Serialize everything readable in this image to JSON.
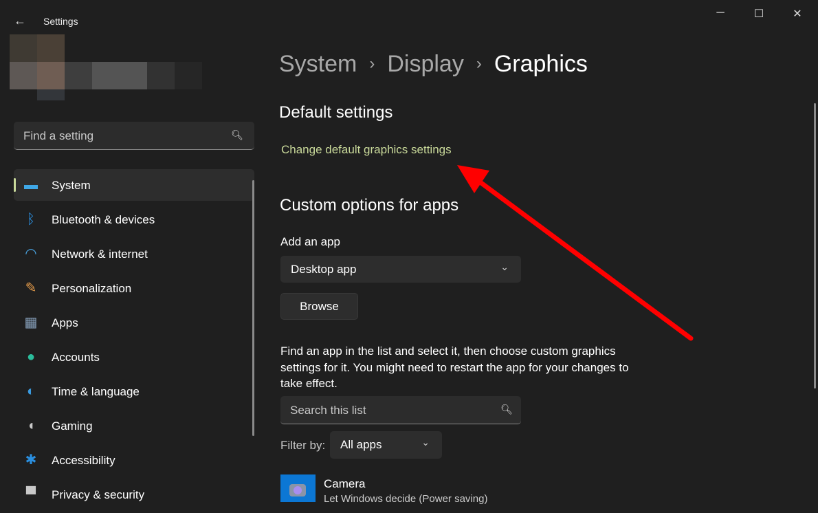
{
  "window": {
    "title": "Settings",
    "back": "←",
    "minimize": "─",
    "maximize": "☐",
    "close": "✕"
  },
  "search": {
    "placeholder": "Find a setting",
    "icon": "search-icon"
  },
  "nav": [
    {
      "label": "System",
      "icon": "monitor-icon",
      "color": "#3fa7e6"
    },
    {
      "label": "Bluetooth & devices",
      "icon": "bluetooth-icon",
      "color": "#2a8fe0"
    },
    {
      "label": "Network & internet",
      "icon": "wifi-icon",
      "color": "#4aa8e8"
    },
    {
      "label": "Personalization",
      "icon": "brush-icon",
      "color": "#e49b4a"
    },
    {
      "label": "Apps",
      "icon": "apps-icon",
      "color": "#8aa4c0"
    },
    {
      "label": "Accounts",
      "icon": "person-icon",
      "color": "#2bbd9c"
    },
    {
      "label": "Time & language",
      "icon": "globe-clock-icon",
      "color": "#3a9be0"
    },
    {
      "label": "Gaming",
      "icon": "gamepad-icon",
      "color": "#c8c8c8"
    },
    {
      "label": "Accessibility",
      "icon": "accessibility-icon",
      "color": "#2a8fe0"
    },
    {
      "label": "Privacy & security",
      "icon": "shield-icon",
      "color": "#c8c8c8"
    }
  ],
  "breadcrumb": [
    "System",
    "Display",
    "Graphics"
  ],
  "breadcrumb_sep": "›",
  "main": {
    "default_heading": "Default settings",
    "default_link": "Change default graphics settings",
    "custom_heading": "Custom options for apps",
    "add_app_label": "Add an app",
    "app_type": "Desktop app",
    "browse": "Browse",
    "description": "Find an app in the list and select it, then choose custom graphics settings for it. You might need to restart the app for your changes to take effect.",
    "list_search_placeholder": "Search this list",
    "filter_label": "Filter by:",
    "filter_value": "All apps",
    "apps": [
      {
        "name": "Camera",
        "setting": "Let Windows decide (Power saving)"
      }
    ]
  },
  "annotation_color": "#ff0000"
}
